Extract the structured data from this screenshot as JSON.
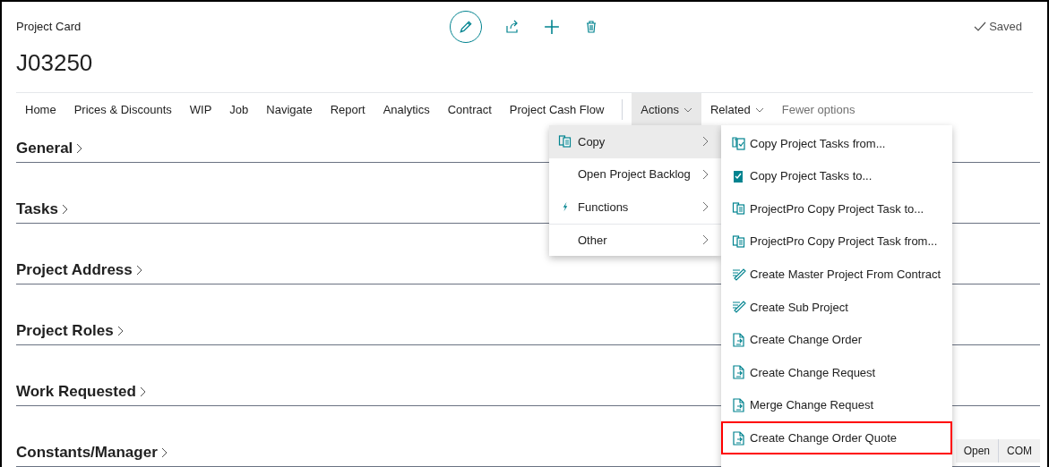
{
  "header": {
    "caption": "Project Card",
    "title": "J03250",
    "status": "Saved"
  },
  "tabs": [
    {
      "label": "Home",
      "kind": "tab",
      "selected": false
    },
    {
      "label": "Prices & Discounts",
      "kind": "tab",
      "selected": false
    },
    {
      "label": "WIP",
      "kind": "tab",
      "selected": false
    },
    {
      "label": "Job",
      "kind": "tab",
      "selected": false
    },
    {
      "label": "Navigate",
      "kind": "tab",
      "selected": false
    },
    {
      "label": "Report",
      "kind": "tab",
      "selected": false
    },
    {
      "label": "Analytics",
      "kind": "tab",
      "selected": false
    },
    {
      "label": "Contract",
      "kind": "tab",
      "selected": false
    },
    {
      "label": "Project Cash Flow",
      "kind": "tab",
      "selected": false
    },
    {
      "label": "Actions",
      "kind": "dropdown",
      "selected": true
    },
    {
      "label": "Related",
      "kind": "dropdown",
      "selected": false
    },
    {
      "label": "Fewer options",
      "kind": "link",
      "selected": false
    }
  ],
  "sections": [
    {
      "title": "General"
    },
    {
      "title": "Tasks"
    },
    {
      "title": "Project Address"
    },
    {
      "title": "Project Roles"
    },
    {
      "title": "Work Requested"
    },
    {
      "title": "Constants/Manager"
    }
  ],
  "menu": [
    {
      "label": "Copy",
      "kind": "copy",
      "selected": true
    },
    {
      "label": "Open Project Backlog",
      "kind": "plain",
      "selected": false
    },
    {
      "label": "Functions",
      "kind": "bolt",
      "selected": false
    },
    {
      "label": "Other",
      "kind": "plain",
      "selected": false
    }
  ],
  "submenu": [
    {
      "label": "Copy Project Tasks from...",
      "kind": "tasks-from",
      "selected": false
    },
    {
      "label": "Copy Project Tasks to...",
      "kind": "tasks-to",
      "selected": false
    },
    {
      "label": "ProjectPro Copy Project Task to...",
      "kind": "copy",
      "selected": false
    },
    {
      "label": "ProjectPro Copy Project Task from...",
      "kind": "copy",
      "selected": false
    },
    {
      "label": "Create Master Project From Contract",
      "kind": "wand",
      "selected": false
    },
    {
      "label": "Create Sub Project",
      "kind": "wand",
      "selected": false
    },
    {
      "label": "Create Change Order",
      "kind": "change",
      "selected": false
    },
    {
      "label": "Create Change Request",
      "kind": "change",
      "selected": false
    },
    {
      "label": "Merge Change Request",
      "kind": "change",
      "selected": false
    },
    {
      "label": "Create Change Order Quote",
      "kind": "change",
      "selected": true
    }
  ],
  "footer_cells": [
    "Open",
    "COM"
  ]
}
